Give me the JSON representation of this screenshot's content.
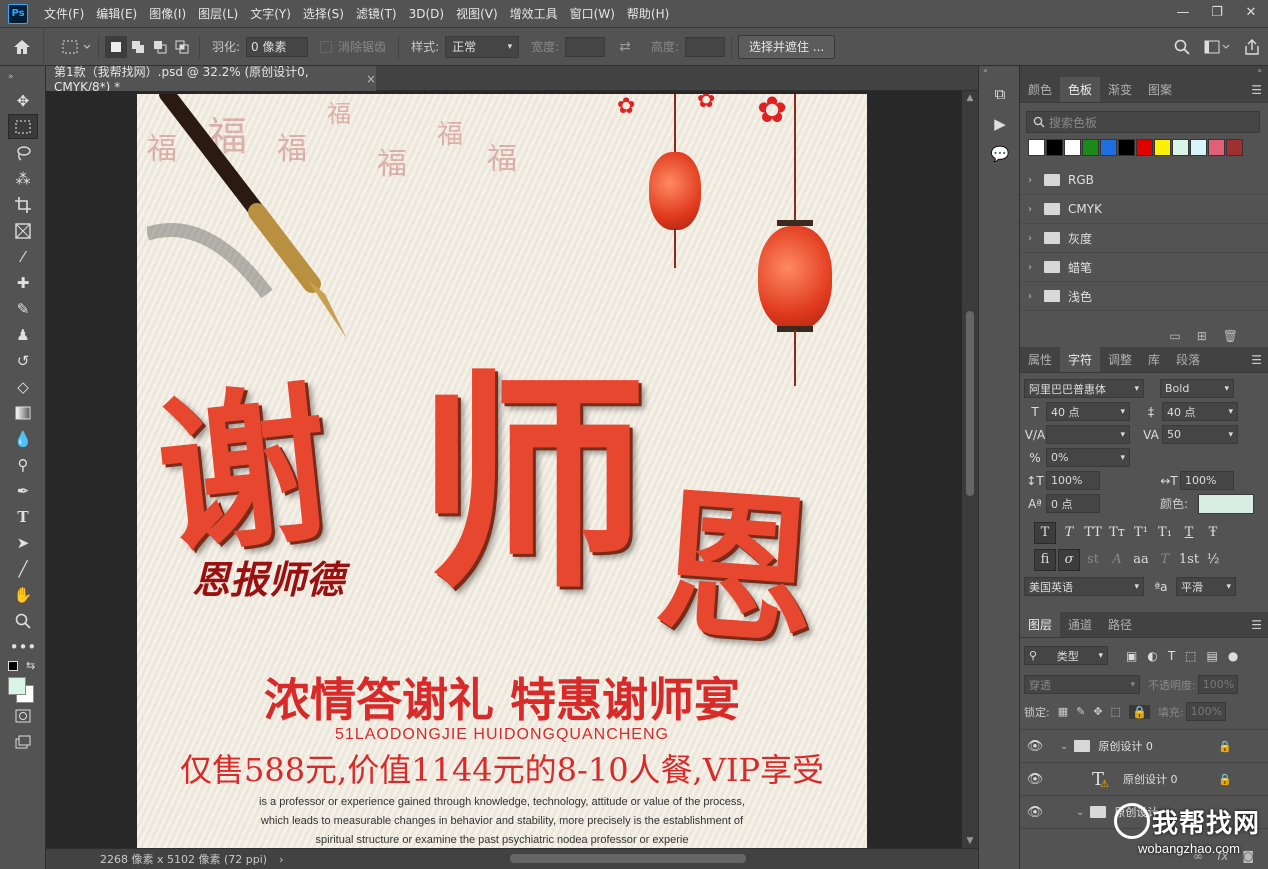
{
  "app": {
    "logo": "Ps",
    "menu": [
      "文件(F)",
      "编辑(E)",
      "图像(I)",
      "图层(L)",
      "文字(Y)",
      "选择(S)",
      "滤镜(T)",
      "3D(D)",
      "视图(V)",
      "增效工具",
      "窗口(W)",
      "帮助(H)"
    ],
    "window_controls": [
      "—",
      "❐",
      "✕"
    ]
  },
  "options": {
    "feather_label": "羽化:",
    "feather_value": "0 像素",
    "antialias_label": "消除锯齿",
    "style_label": "样式:",
    "style_value": "正常",
    "width_label": "宽度:",
    "height_label": "高度:",
    "select_mask_button": "选择并遮住 ..."
  },
  "document": {
    "tab_title": "第1款（我帮找网）.psd @ 32.2% (原创设计0, CMYK/8*) *",
    "tab_close": "×",
    "status": "2268 像素 x 5102 像素 (72 ppi)",
    "status_arrow": "›"
  },
  "poster": {
    "fu_chars": [
      "福",
      "福",
      "福",
      "福",
      "福",
      "福",
      "福"
    ],
    "title_chars": [
      "谢",
      "师",
      "恩"
    ],
    "subtitle": "恩报师德",
    "headline": "浓情答谢礼  特惠谢师宴",
    "pinyin": "51LAODONGJIE HUIDONGQUANCHENG",
    "price": "仅售588元,价值1144元的8-10人餐,VIP享受",
    "english": [
      "is a professor or experience gained through knowledge, technology, attitude or value of the process,",
      "which leads to measurable changes in behavior and stability, more precisely is the establishment of",
      "spiritual structure or examine the past psychiatric nodea professor or experie"
    ]
  },
  "swatches_panel": {
    "tabs": [
      "颜色",
      "色板",
      "渐变",
      "图案"
    ],
    "active_tab": "色板",
    "search_placeholder": "搜索色板",
    "colors": [
      "#ffffff",
      "#000000",
      "#ffffff",
      "#1a8a1a",
      "#1e6fe0",
      "#000000",
      "#e00000",
      "#ffef00",
      "#d8f5e8",
      "#d8f5f8",
      "#e0607a",
      "#a03030"
    ],
    "folders": [
      "RGB",
      "CMYK",
      "灰度",
      "蜡笔",
      "浅色"
    ]
  },
  "character_panel": {
    "tabs": [
      "属性",
      "字符",
      "调整",
      "库",
      "段落"
    ],
    "active_tab": "字符",
    "font_family": "阿里巴巴普惠体",
    "font_style": "Bold",
    "font_size": "40 点",
    "leading": "40 点",
    "kerning": "",
    "tracking": "50",
    "tsume": "0%",
    "vertical_scale": "100%",
    "horizontal_scale": "100%",
    "baseline_shift": "0 点",
    "color_label": "颜色:",
    "color_value": "#d8eee2",
    "type_buttons_1": [
      "T",
      "T",
      "TT",
      "Tт",
      "T¹",
      "T₁",
      "T",
      "Ŧ"
    ],
    "type_buttons_2": [
      "fi",
      "σ",
      "st",
      "A",
      "aa",
      "T",
      "1st",
      "½"
    ],
    "language": "美国英语",
    "aa_label": "ªa",
    "antialias": "平滑"
  },
  "layers_panel": {
    "tabs": [
      "图层",
      "通道",
      "路径"
    ],
    "active_tab": "图层",
    "filter_kind": "类型",
    "blend_mode": "穿透",
    "opacity_label": "不透明度:",
    "opacity_value": "100%",
    "lock_label": "锁定:",
    "fill_label": "填充:",
    "fill_value": "100%",
    "layers": [
      {
        "name": "原创设计 0",
        "type": "group"
      },
      {
        "name": "原创设计 0",
        "type": "text"
      },
      {
        "name": "原创设计",
        "type": "group"
      }
    ]
  },
  "watermark": {
    "top": "我帮找网",
    "bottom": "wobangzhao.com"
  }
}
